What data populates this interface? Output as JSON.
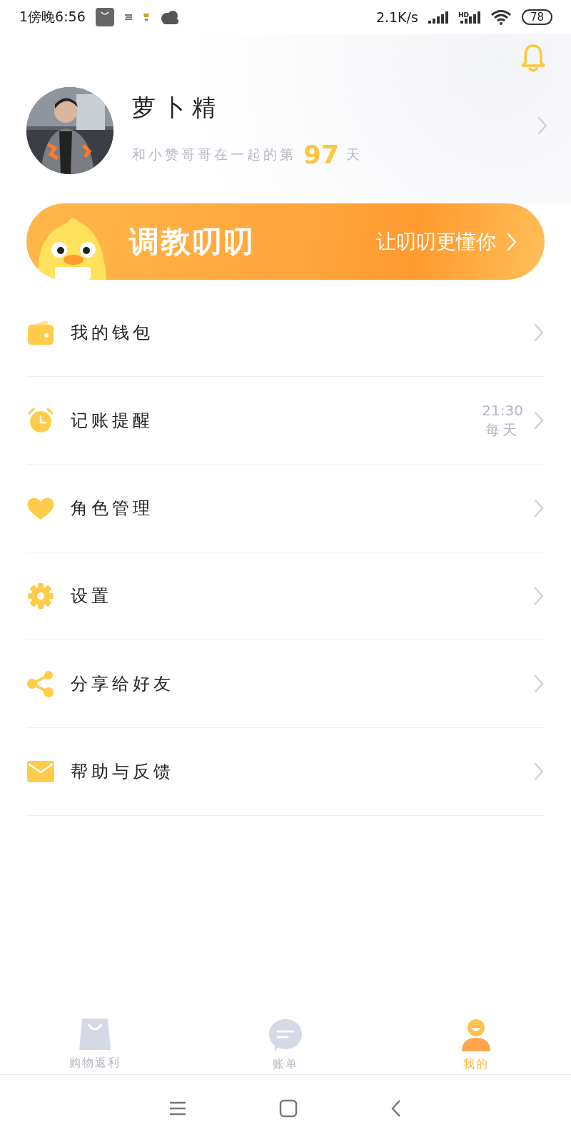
{
  "status_bar": {
    "time": "1傍晚6:56",
    "network_speed": "2.1K/s",
    "hd_label": "HD",
    "battery": "78"
  },
  "profile": {
    "name": "萝卜精",
    "together_prefix": "和小赞哥哥在一起的第",
    "days": "97",
    "together_suffix": "天"
  },
  "banner": {
    "title": "调教叨叨",
    "subtitle": "让叨叨更懂你"
  },
  "menu": [
    {
      "label": "我的钱包"
    },
    {
      "label": "记账提醒",
      "time": "21:30",
      "repeat": "每天"
    },
    {
      "label": "角色管理"
    },
    {
      "label": "设置"
    },
    {
      "label": "分享给好友"
    },
    {
      "label": "帮助与反馈"
    }
  ],
  "tabs": [
    {
      "label": "购物返利",
      "selected": false
    },
    {
      "label": "账单",
      "selected": false
    },
    {
      "label": "我的",
      "selected": true
    }
  ]
}
